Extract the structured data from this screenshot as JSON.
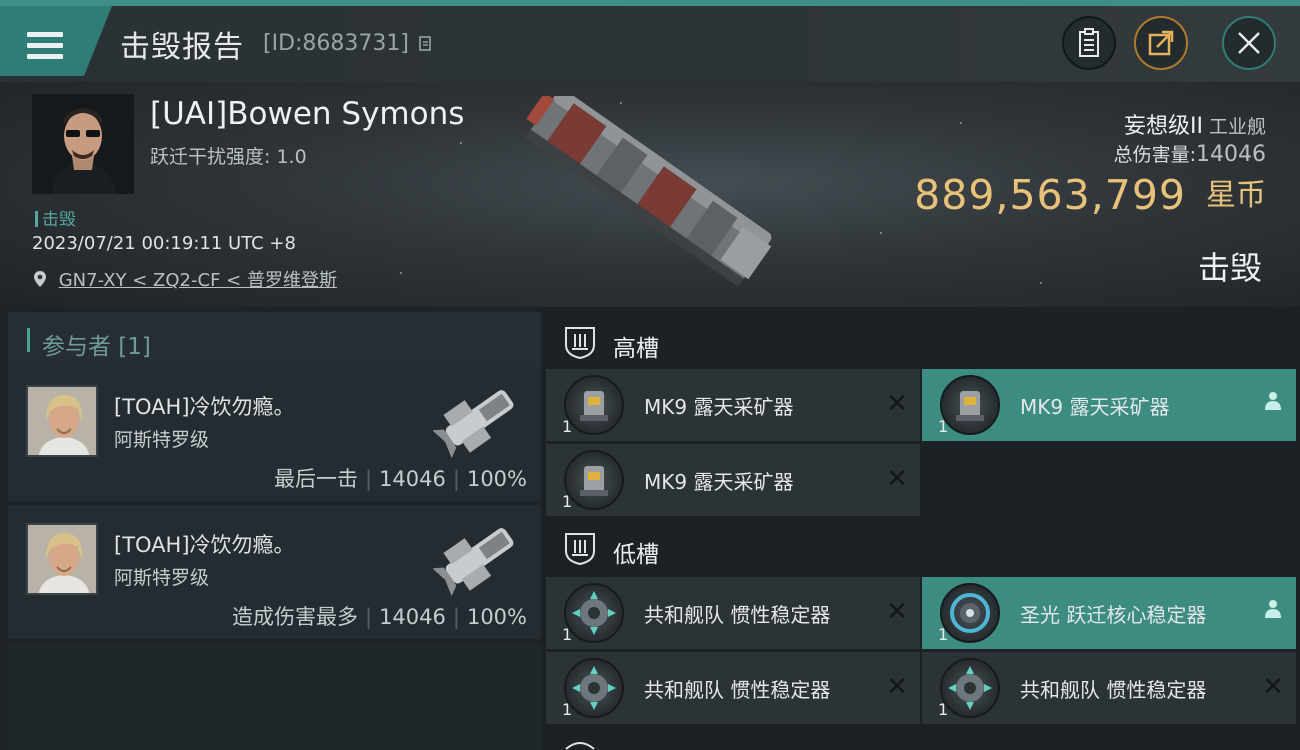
{
  "header": {
    "title": "击毁报告",
    "id_text": "[ID:8683731]"
  },
  "victim": {
    "name": "[UAI]Bowen Symons",
    "warp_label": "跃迁干扰强度: 1.0",
    "kill_tag": "击毁",
    "time": "2023/07/21 00:19:11 UTC +8",
    "location": "GN7-XY < ZQ2-CF < 普罗维登斯",
    "ship_name": "妄想级II",
    "ship_class": "工业舰",
    "total_damage_label": "总伤害量:",
    "total_damage": "14046",
    "isk_value": "889,563,799",
    "isk_unit": "星币",
    "status": "击毁"
  },
  "participants": {
    "header": "参与者 [1]",
    "rows": [
      {
        "name": "[TOAH]冷饮勿瘾。",
        "ship": "阿斯特罗级",
        "role": "最后一击",
        "damage": "14046",
        "percent": "100%"
      },
      {
        "name": "[TOAH]冷饮勿瘾。",
        "ship": "阿斯特罗级",
        "role": "造成伤害最多",
        "damage": "14046",
        "percent": "100%"
      }
    ]
  },
  "fitting": {
    "high_slot_label": "高槽",
    "low_slot_label": "低槽",
    "high_slots": [
      {
        "name": "MK9 露天采矿器",
        "qty": "1",
        "state": "destroyed"
      },
      {
        "name": "MK9 露天采矿器",
        "qty": "1",
        "state": "dropped"
      },
      {
        "name": "MK9 露天采矿器",
        "qty": "1",
        "state": "destroyed"
      }
    ],
    "low_slots": [
      {
        "name": "共和舰队 惯性稳定器",
        "qty": "1",
        "state": "destroyed"
      },
      {
        "name": "圣光 跃迁核心稳定器",
        "qty": "1",
        "state": "dropped"
      },
      {
        "name": "共和舰队 惯性稳定器",
        "qty": "1",
        "state": "destroyed"
      },
      {
        "name": "共和舰队 惯性稳定器",
        "qty": "1",
        "state": "destroyed"
      }
    ],
    "destroyed_mark": "✕"
  },
  "colors": {
    "accent": "#3c8c82",
    "isk": "#e9c27a",
    "header_topline": "#3e8f86"
  },
  "icons": [
    "menu-icon",
    "copy-icon",
    "clipboard-icon",
    "share-icon",
    "close-icon",
    "location-pin-icon",
    "shield-slot-icon",
    "person-icon"
  ]
}
